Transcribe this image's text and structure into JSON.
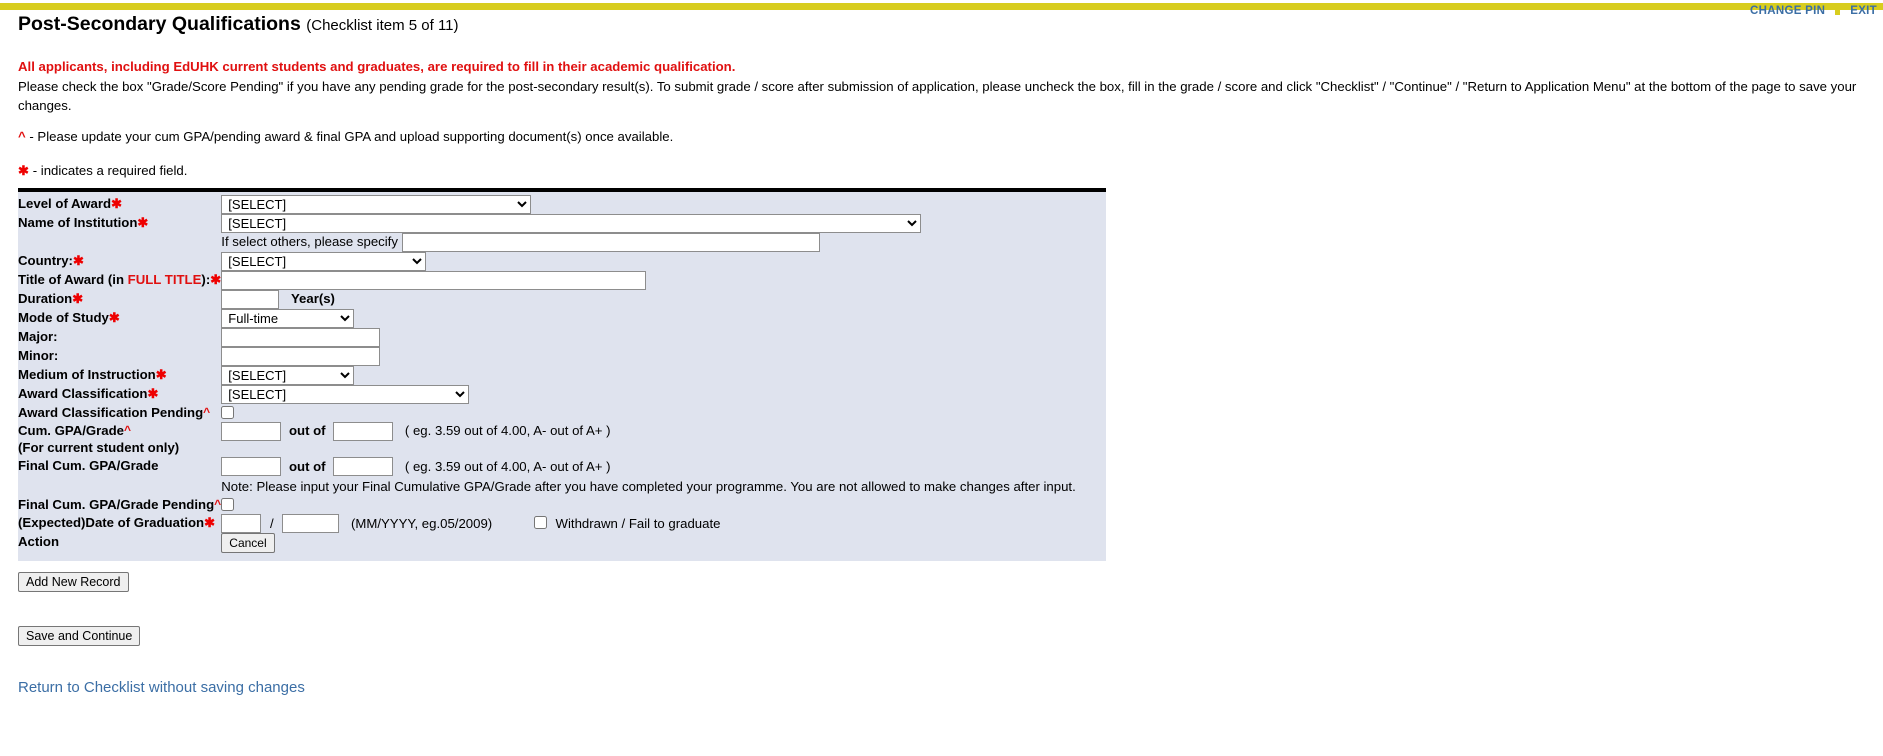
{
  "topbar": {
    "change_pin": "CHANGE PIN",
    "exit": "EXIT",
    "bar_color": "#d8cd1e",
    "link_color": "#3b6ea5"
  },
  "header": {
    "title": "Post-Secondary Qualifications",
    "subtitle": "(Checklist item 5 of 11)"
  },
  "instructions": {
    "alert": "All applicants, including EdUHK current students and graduates, are required to fill in their academic qualification.",
    "body": "Please check the box \"Grade/Score Pending\" if you have any pending grade for the post-secondary result(s). To submit grade / score after submission of application, please uncheck the box, fill in the grade / score and click \"Checklist\" / \"Continue\" / \"Return to Application Menu\" at the bottom of the page to save your changes.",
    "caret_mark": "^",
    "caret_note": " - Please update your cum GPA/pending award & final GPA and upload supporting document(s) once available.",
    "required_mark": "✱",
    "required_note": " - indicates a required field."
  },
  "form": {
    "level_of_award": {
      "label": "Level of Award",
      "required_mark": "✱",
      "value": "[SELECT]"
    },
    "name_of_institution": {
      "label": "Name of Institution",
      "required_mark": "✱",
      "value": "[SELECT]"
    },
    "specify_other": {
      "label": "If select others, please specify",
      "value": ""
    },
    "country": {
      "label": "Country:",
      "required_mark": "✱",
      "value": "[SELECT]"
    },
    "title_of_award": {
      "label_pre": "Title of Award (in ",
      "label_red": "FULL TITLE",
      "label_post": "):",
      "required_mark": "✱",
      "value": ""
    },
    "duration": {
      "label": "Duration",
      "required_mark": "✱",
      "value": "",
      "unit": "Year(s)"
    },
    "mode_of_study": {
      "label": "Mode of Study",
      "required_mark": "✱",
      "value": "Full-time"
    },
    "major": {
      "label": "Major:",
      "value": ""
    },
    "minor": {
      "label": "Minor:",
      "value": ""
    },
    "medium_of_instruction": {
      "label": "Medium of Instruction",
      "required_mark": "✱",
      "value": "[SELECT]"
    },
    "award_classification": {
      "label": "Award Classification",
      "required_mark": "✱",
      "value": "[SELECT]"
    },
    "award_classification_pending": {
      "label": "Award Classification Pending",
      "caret": "^",
      "checked": false
    },
    "cum_gpa": {
      "label": "Cum. GPA/Grade",
      "caret": "^",
      "sublabel": "(For current student only)",
      "value": "",
      "out_of_label": "out of",
      "out_of_value": "",
      "example": "( eg. 3.59 out of 4.00, A- out of A+ )"
    },
    "final_cum_gpa": {
      "label": "Final Cum. GPA/Grade",
      "value": "",
      "out_of_label": "out of",
      "out_of_value": "",
      "example": "( eg. 3.59 out of 4.00, A- out of A+ )",
      "note": "Note: Please input your Final Cumulative GPA/Grade after you have completed your programme. You are not allowed to make changes after input."
    },
    "final_cum_gpa_pending": {
      "label": "Final Cum. GPA/Grade Pending",
      "caret": "^",
      "checked": false
    },
    "graduation_date": {
      "label": "(Expected)Date of Graduation",
      "required_mark": "✱",
      "month": "",
      "separator": "/",
      "year": "",
      "format_hint": "(MM/YYYY, eg.05/2009)",
      "withdrawn_label": "Withdrawn / Fail to graduate",
      "withdrawn_checked": false
    },
    "action": {
      "label": "Action",
      "cancel_label": "Cancel"
    }
  },
  "footer": {
    "add_new_record": "Add New Record",
    "save_and_continue": "Save and Continue",
    "return_link": "Return to Checklist without saving changes"
  }
}
